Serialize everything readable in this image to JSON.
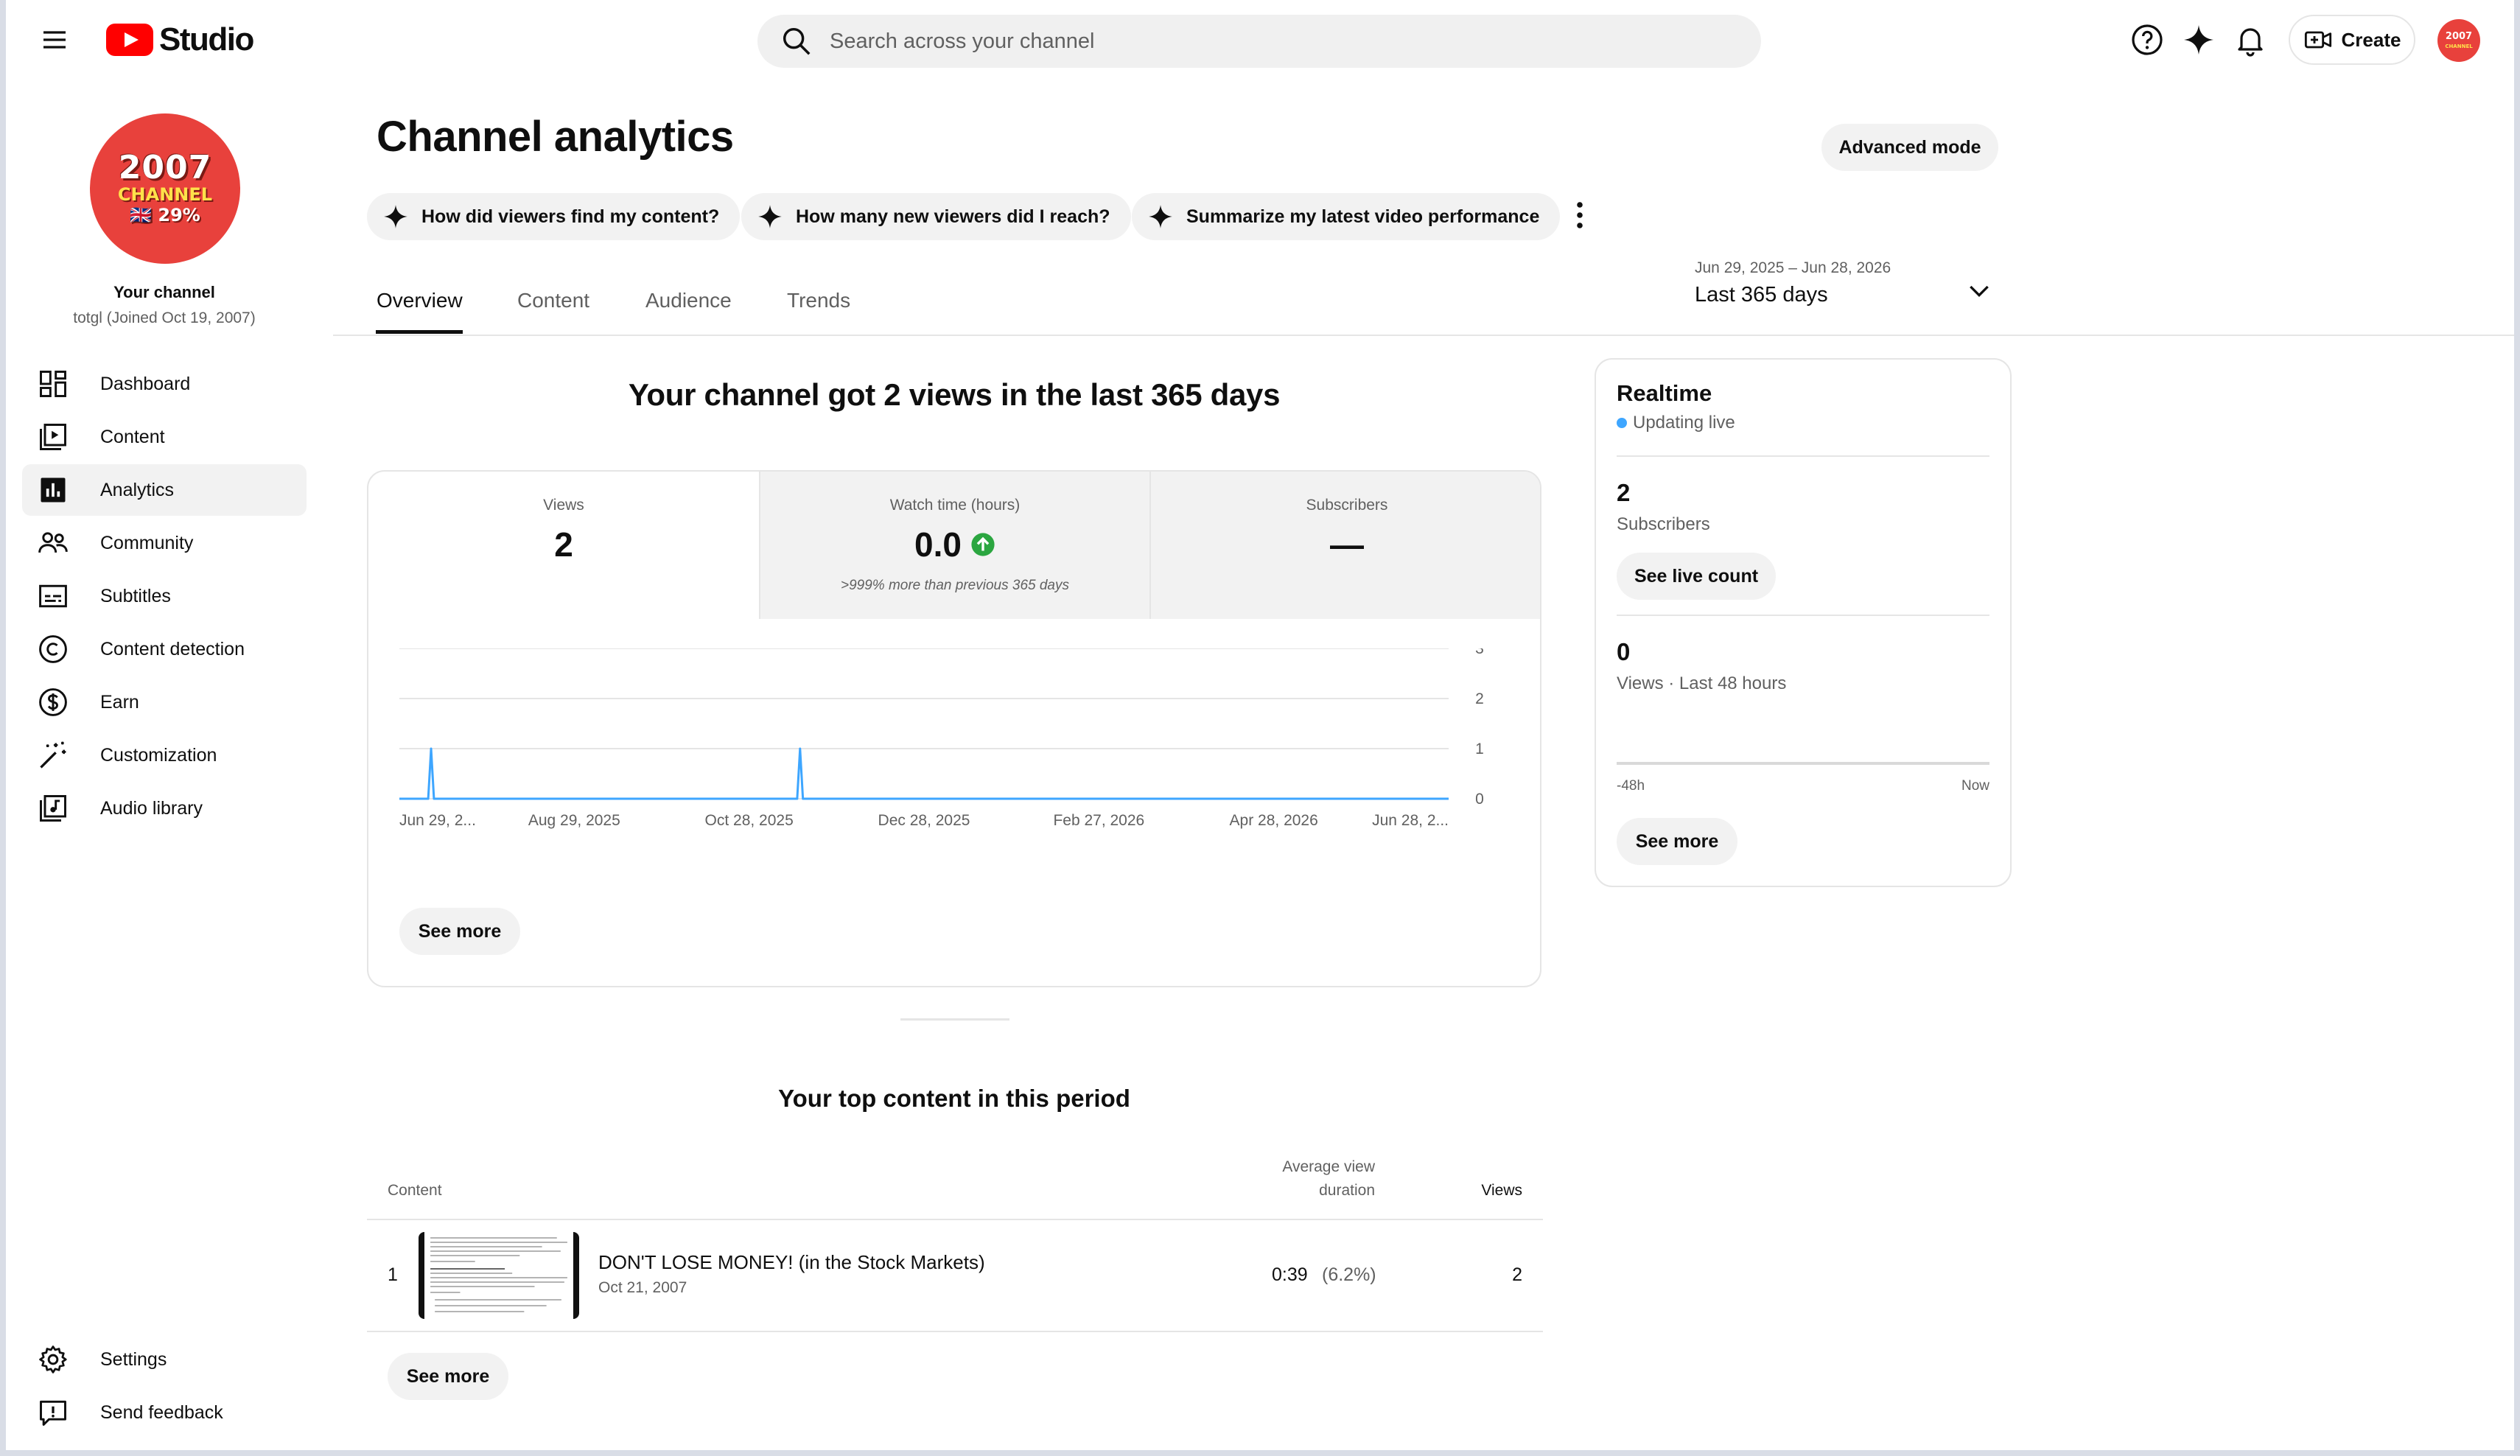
{
  "header": {
    "logo_text": "Studio",
    "search_placeholder": "Search across your channel",
    "create_label": "Create"
  },
  "sidebar": {
    "avatar": {
      "year": "2007",
      "word": "CHANNEL",
      "percent": "🇬🇧 29%"
    },
    "channel_title": "Your channel",
    "channel_sub": "totgl (Joined Oct 19, 2007)",
    "items": [
      {
        "label": "Dashboard",
        "icon": "dashboard-icon"
      },
      {
        "label": "Content",
        "icon": "content-icon"
      },
      {
        "label": "Analytics",
        "icon": "analytics-icon",
        "active": true
      },
      {
        "label": "Community",
        "icon": "community-icon"
      },
      {
        "label": "Subtitles",
        "icon": "subtitles-icon"
      },
      {
        "label": "Content detection",
        "icon": "copyright-icon"
      },
      {
        "label": "Earn",
        "icon": "dollar-icon"
      },
      {
        "label": "Customization",
        "icon": "magic-wand-icon"
      },
      {
        "label": "Audio library",
        "icon": "audio-library-icon"
      }
    ],
    "bottom": [
      {
        "label": "Settings",
        "icon": "gear-icon"
      },
      {
        "label": "Send feedback",
        "icon": "feedback-icon"
      }
    ]
  },
  "main": {
    "title": "Channel analytics",
    "advanced_mode": "Advanced mode",
    "chips": [
      "How did viewers find my content?",
      "How many new viewers did I reach?",
      "Summarize my latest video performance"
    ],
    "tabs": [
      "Overview",
      "Content",
      "Audience",
      "Trends"
    ],
    "active_tab": "Overview",
    "date_range": "Jun 29, 2025 – Jun 28, 2026",
    "date_label": "Last 365 days",
    "headline": "Your channel got 2 views in the last 365 days",
    "metrics": [
      {
        "label": "Views",
        "value": "2"
      },
      {
        "label": "Watch time (hours)",
        "value": "0.0",
        "note": ">999% more than previous 365 days"
      },
      {
        "label": "Subscribers",
        "value": "—"
      }
    ],
    "chart_see_more": "See more",
    "top_content": {
      "title": "Your top content in this period",
      "col_content": "Content",
      "col_avd_1": "Average view",
      "col_avd_2": "duration",
      "col_views": "Views",
      "rows": [
        {
          "rank": "1",
          "title": "DON'T LOSE MONEY! (in the Stock Markets)",
          "date": "Oct 21, 2007",
          "avd": "0:39",
          "avd_pct": "(6.2%)",
          "views": "2"
        }
      ],
      "see_more": "See more"
    }
  },
  "chart_data": {
    "type": "line",
    "x_labels": [
      "Jun 29, 2...",
      "Aug 29, 2025",
      "Oct 28, 2025",
      "Dec 28, 2025",
      "Feb 27, 2026",
      "Apr 28, 2026",
      "Jun 28, 2..."
    ],
    "x_start": "2025-06-29",
    "x_end": "2026-06-28",
    "y_ticks": [
      0,
      1,
      2,
      3
    ],
    "ylim": [
      0,
      3
    ],
    "series": [
      {
        "points": [
          [
            "2025-06-29",
            0
          ],
          [
            "2025-07-10",
            1
          ],
          [
            "2025-11-15",
            1
          ]
        ],
        "color": "#3ea6ff"
      }
    ],
    "grid": true
  },
  "realtime": {
    "title": "Realtime",
    "status": "Updating live",
    "subscribers_value": "2",
    "subscribers_label": "Subscribers",
    "see_live_count": "See live count",
    "views_value": "0",
    "views_label": "Views · Last 48 hours",
    "axis_start": "-48h",
    "axis_end": "Now",
    "see_more": "See more"
  },
  "colors": {
    "brand_red": "#ff0000",
    "accent_blue": "#3ea6ff",
    "positive_green": "#2ba640",
    "avatar_red": "#e8413c"
  }
}
